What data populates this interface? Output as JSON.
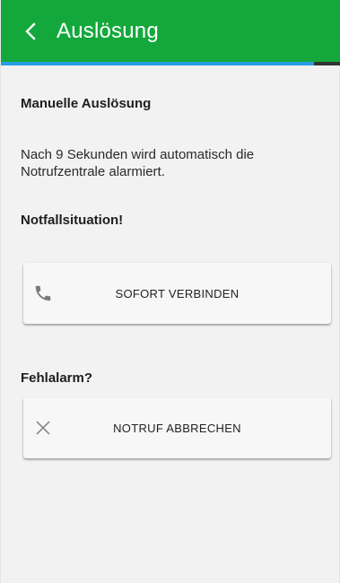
{
  "app_bar": {
    "title": "Auslösung",
    "back_icon": "chevron-left-icon",
    "background_color": "#14a83c"
  },
  "countdown_progress": {
    "fraction_elapsed": 0.92,
    "fill_color": "#2a9be6",
    "track_color": "#333333"
  },
  "manual_section": {
    "heading": "Manuelle Auslösung",
    "message": "Nach 9 Sekunden wird automatisch die Notrufzentrale alarmiert."
  },
  "emergency_section": {
    "heading": "Notfallsituation!",
    "button_label": "SOFORT VERBINDEN",
    "button_icon": "phone-icon"
  },
  "false_alarm_section": {
    "heading": "Fehlalarm?",
    "button_label": "NOTRUF ABBRECHEN",
    "button_icon": "close-icon"
  }
}
